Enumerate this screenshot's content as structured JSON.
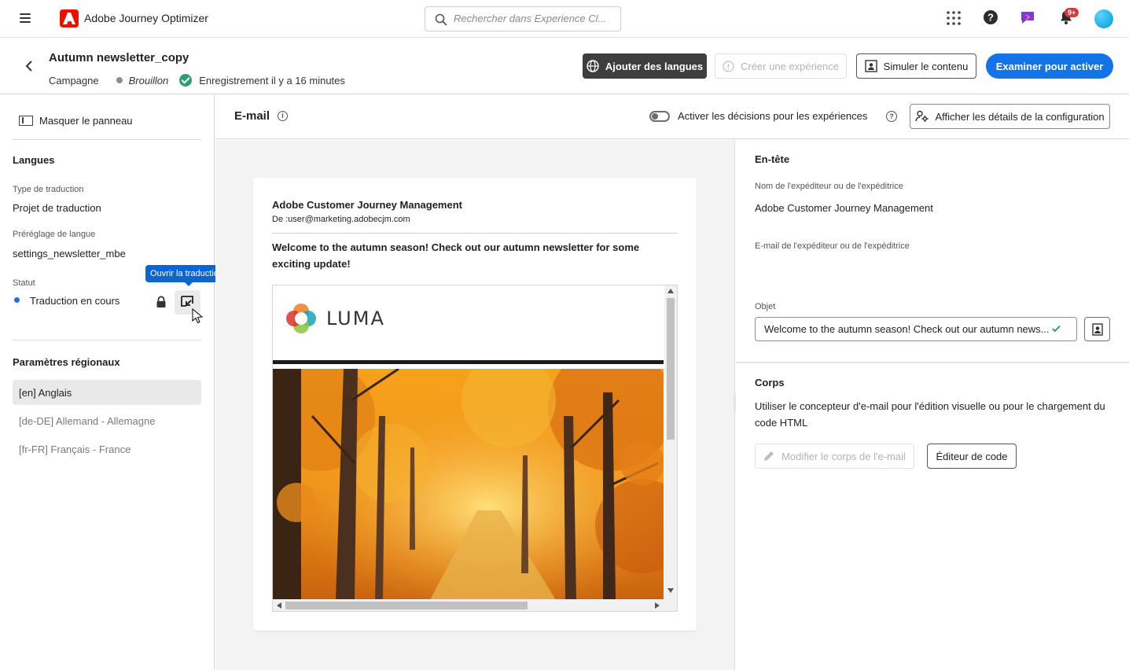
{
  "app": {
    "title": "Adobe Journey Optimizer",
    "notification_count": "9+"
  },
  "search": {
    "placeholder": "Rechercher dans Experience Cl..."
  },
  "campaign": {
    "title": "Autumn newsletter_copy",
    "type": "Campagne",
    "status": "Brouillon",
    "saved": "Enregistrement il y a 16 minutes"
  },
  "toolbar": {
    "add_languages": "Ajouter des langues",
    "create_experience": "Créer une expérience",
    "simulate": "Simuler le contenu",
    "review": "Examiner pour activer"
  },
  "left_panel": {
    "hide_panel": "Masquer le panneau",
    "languages_title": "Langues",
    "translation_type_label": "Type de traduction",
    "translation_type_value": "Projet de traduction",
    "preset_label": "Préréglage de langue",
    "preset_value": "settings_newsletter_mbe",
    "status_label": "Statut",
    "status_value": "Traduction en cours",
    "tooltip": "Ouvrir la traduction",
    "regional_title": "Paramètres régionaux",
    "locales": [
      "[en] Anglais",
      "[de-DE] Allemand - Allemagne",
      "[fr-FR] Français - France"
    ]
  },
  "email_bar": {
    "title": "E-mail",
    "toggle_label": "Activer les décisions pour les expériences",
    "config_button": "Afficher les détails de la configuration"
  },
  "preview": {
    "sender_name": "Adobe Customer Journey Management",
    "from": "De :user@marketing.adobecjm.com",
    "subject": "Welcome to the autumn season! Check out our autumn newsletter for some exciting update!",
    "brand": "LUMA"
  },
  "right_panel": {
    "header_title": "En-tête",
    "sender_name_label": "Nom de l'expéditeur ou de l'expéditrice",
    "sender_name_value": "Adobe Customer Journey Management",
    "sender_email_label": "E-mail de l'expéditeur ou de l'expéditrice",
    "subject_label": "Objet",
    "subject_value": "Welcome to the autumn season! Check out our autumn news...",
    "body_title": "Corps",
    "body_description": "Utiliser le concepteur d'e-mail pour l'édition visuelle ou pour le chargement du code HTML",
    "edit_body": "Modifier le corps de l'e-mail",
    "code_editor": "Éditeur de code"
  },
  "colors": {
    "primary": "#1473e6",
    "adobe_red": "#eb1000",
    "success": "#2d9d78"
  }
}
